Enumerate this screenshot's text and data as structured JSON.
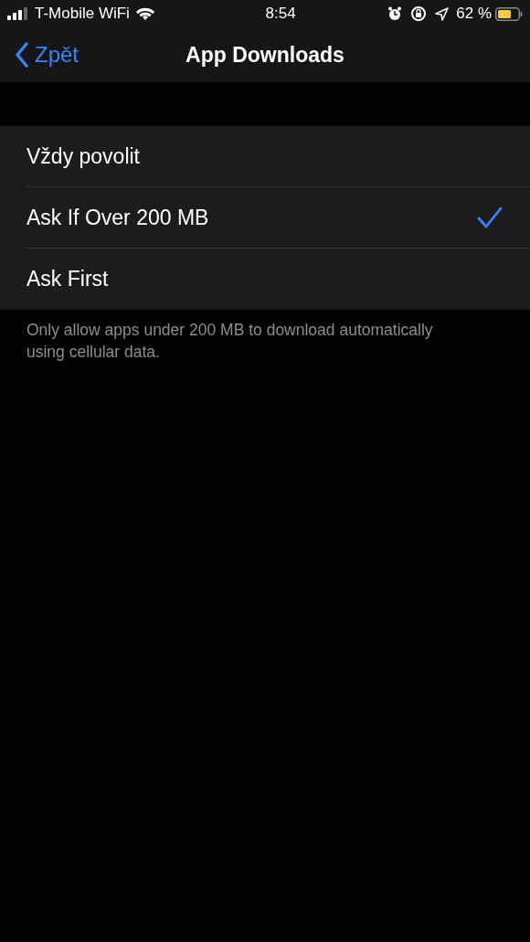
{
  "status_bar": {
    "carrier": "T-Mobile WiFi",
    "time": "8:54",
    "battery": "62 %"
  },
  "nav": {
    "back": "Zpět",
    "title": "App Downloads"
  },
  "options": [
    {
      "label": "Vždy povolit",
      "selected": false
    },
    {
      "label": "Ask If Over 200 MB",
      "selected": true
    },
    {
      "label": "Ask First",
      "selected": false
    }
  ],
  "footer": "Only allow apps under 200 MB to download automatically using cellular data."
}
